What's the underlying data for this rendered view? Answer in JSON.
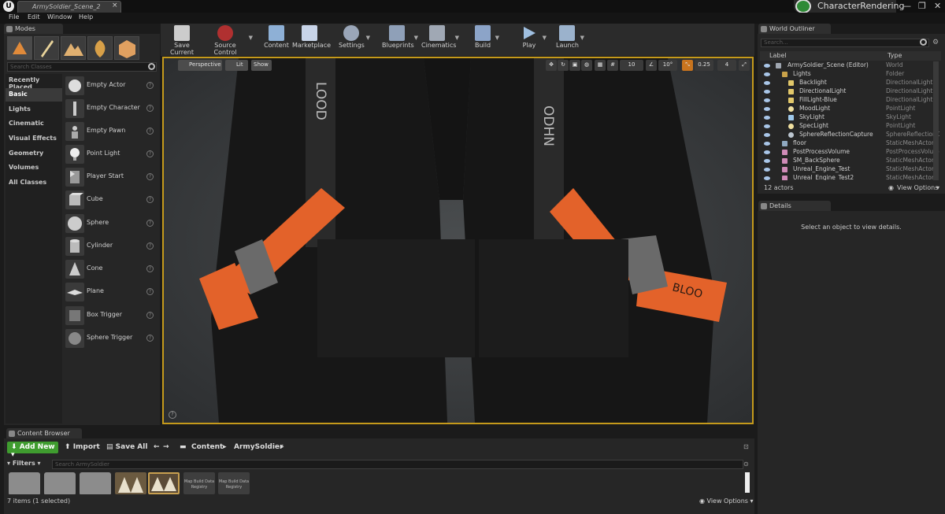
{
  "window": {
    "doc_tab": "ArmySoldier_Scene_2",
    "project": "CharacterRendering",
    "close_glyph": "×"
  },
  "menu": [
    "File",
    "Edit",
    "Window",
    "Help"
  ],
  "modes": {
    "tab": "Modes",
    "search_placeholder": "Search Classes",
    "categories": [
      "Recently Placed",
      "Basic",
      "Lights",
      "Cinematic",
      "Visual Effects",
      "Geometry",
      "Volumes",
      "All Classes"
    ],
    "selected_category": "Basic",
    "items": [
      "Empty Actor",
      "Empty Character",
      "Empty Pawn",
      "Point Light",
      "Player Start",
      "Cube",
      "Sphere",
      "Cylinder",
      "Cone",
      "Plane",
      "Box Trigger",
      "Sphere Trigger"
    ]
  },
  "toolbar": [
    "Save Current",
    "Source Control",
    "Content",
    "Marketplace",
    "Settings",
    "Blueprints",
    "Cinematics",
    "Build",
    "Play",
    "Launch"
  ],
  "viewport": {
    "perspective": "Perspective",
    "lit": "Lit",
    "show": "Show",
    "grid": "10",
    "angle": "10°",
    "scale": "0.25",
    "cams": "4"
  },
  "outliner": {
    "tab": "World Outliner",
    "search_placeholder": "Search...",
    "col_label": "Label",
    "col_type": "Type",
    "rows": [
      {
        "label": "ArmySoldier_Scene (Editor)",
        "type": "World"
      },
      {
        "label": "Lights",
        "type": "Folder"
      },
      {
        "label": "Backlight",
        "type": "DirectionalLight"
      },
      {
        "label": "DirectionalLight",
        "type": "DirectionalLight"
      },
      {
        "label": "FillLight-Blue",
        "type": "DirectionalLight"
      },
      {
        "label": "MoodLight",
        "type": "PointLight"
      },
      {
        "label": "SkyLight",
        "type": "SkyLight"
      },
      {
        "label": "SpecLight",
        "type": "PointLight"
      },
      {
        "label": "SphereReflectionCapture",
        "type": "SphereReflectionC"
      },
      {
        "label": "floor",
        "type": "StaticMeshActor"
      },
      {
        "label": "PostProcessVolume",
        "type": "PostProcessVolume"
      },
      {
        "label": "SM_BackSphere",
        "type": "StaticMeshActor"
      },
      {
        "label": "Unreal_Engine_Test",
        "type": "StaticMeshActor"
      },
      {
        "label": "Unreal_Engine_Test2",
        "type": "StaticMeshActor"
      }
    ],
    "count": "12 actors",
    "view_options": "View Options"
  },
  "details": {
    "tab": "Details",
    "empty": "Select an object to view details."
  },
  "content_browser": {
    "tab": "Content Browser",
    "add_new": "Add New",
    "import": "Import",
    "save_all": "Save All",
    "path": [
      "Content",
      "ArmySoldier"
    ],
    "filters": "Filters",
    "search_placeholder": "Search ArmySoldier",
    "map_build": "Map Build Data Registry",
    "footer": "7 items (1 selected)",
    "view_options": "View Options"
  },
  "strap_text": {
    "left_strap": "LOOD",
    "right_strap": "ODHN",
    "right_orange": "BLOO"
  },
  "colors": {
    "accent_orange": "#e3622a",
    "viewport_border": "#c59a1b",
    "add_new_green": "#3f9c2f"
  }
}
